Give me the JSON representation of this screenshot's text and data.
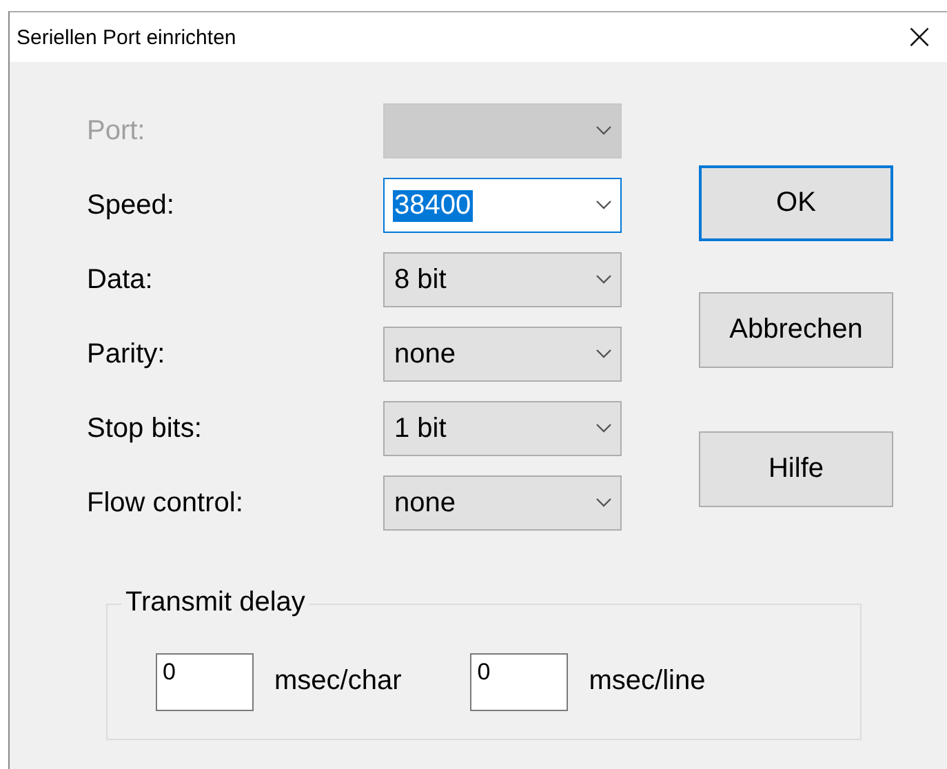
{
  "window": {
    "title": "Seriellen Port einrichten",
    "close": "×"
  },
  "fields": [
    {
      "label": "Port:",
      "disabled": true,
      "selected": false
    },
    {
      "label": "Speed:",
      "value": "38400",
      "disabled": false,
      "selected": true
    },
    {
      "label": "Data:",
      "value": "8 bit",
      "disabled": false,
      "selected": false
    },
    {
      "label": "Parity:",
      "value": "none",
      "disabled": false,
      "selected": false
    },
    {
      "label": "Stop bits:",
      "value": "1 bit",
      "disabled": false,
      "selected": false
    },
    {
      "label": "Flow control:",
      "value": "none",
      "disabled": false,
      "selected": false
    }
  ],
  "buttons": [
    {
      "label": "OK",
      "default": true
    },
    {
      "label": "Abbrechen",
      "default": false
    },
    {
      "label": "Hilfe",
      "default": false
    }
  ],
  "transmit_delay": {
    "title": "Transmit delay",
    "inputs": [
      {
        "value": "0",
        "unit": "msec/char"
      },
      {
        "value": "0",
        "unit": "msec/line"
      }
    ]
  }
}
